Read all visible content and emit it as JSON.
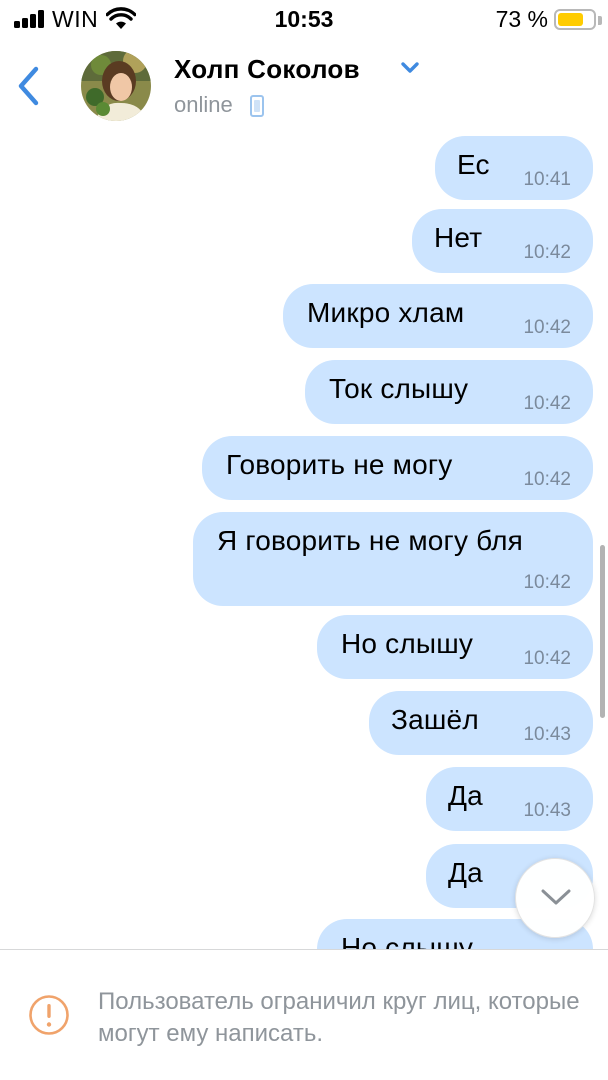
{
  "status_bar": {
    "carrier": "WIN",
    "time": "10:53",
    "battery_percent": "73 %",
    "battery_level": 0.73,
    "icons": [
      "signal-icon",
      "wifi-icon",
      "battery-icon"
    ]
  },
  "header": {
    "back_icon": "chevron-left-icon",
    "contact_name": "Холп Соколов",
    "dropdown_icon": "chevron-down-icon",
    "status": "online",
    "status_icon": "mobile-phone-icon",
    "accent_color": "#3f8ae0"
  },
  "messages": [
    {
      "text": "Ес",
      "time": "10:41"
    },
    {
      "text": "Нет",
      "time": "10:42"
    },
    {
      "text": "Микро хлам",
      "time": "10:42"
    },
    {
      "text": "Ток слышу",
      "time": "10:42"
    },
    {
      "text": "Говорить не могу",
      "time": "10:42"
    },
    {
      "text": "Я говорить не могу бля",
      "time": "10:42"
    },
    {
      "text": "Но слышу",
      "time": "10:42"
    },
    {
      "text": "Зашёл",
      "time": "10:43"
    },
    {
      "text": "Да",
      "time": "10:43"
    },
    {
      "text": "Да",
      "time": ""
    },
    {
      "text": "Но слышу",
      "time": ""
    }
  ],
  "colors": {
    "outgoing_bubble": "#cce4ff",
    "time_text": "#7b8a9c",
    "warning": "#f0a36b"
  },
  "scroll_down_icon": "chevron-down-icon",
  "notice": {
    "icon": "warning-icon",
    "text": "Пользователь ограничил круг лиц, которые могут ему написать."
  }
}
